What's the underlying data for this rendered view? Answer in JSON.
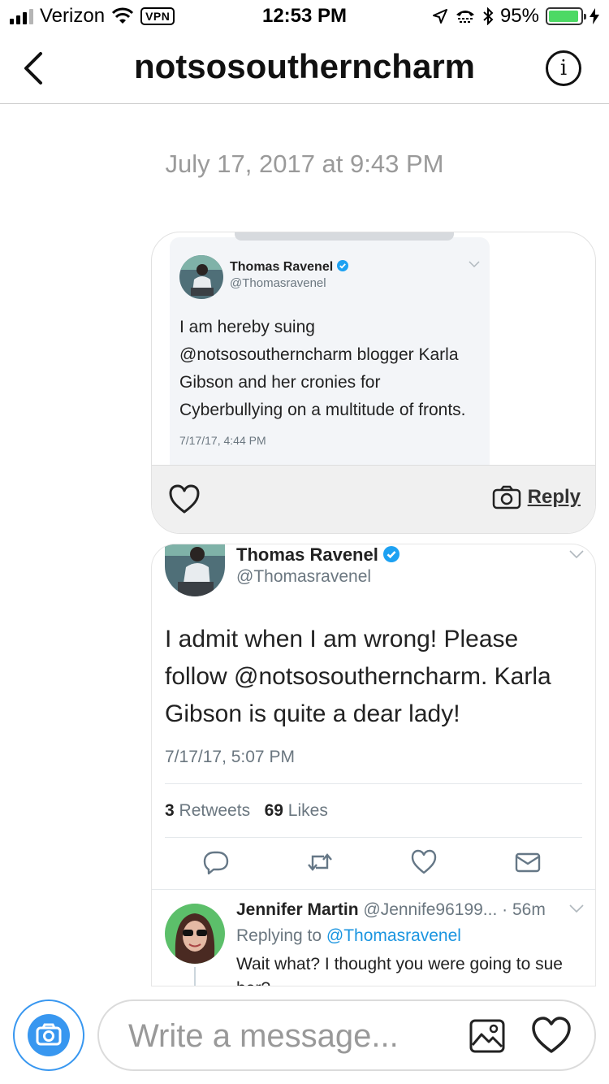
{
  "status_bar": {
    "carrier": "Verizon",
    "vpn": "VPN",
    "time": "12:53 PM",
    "battery": "95%",
    "battery_level": 0.95,
    "battery_color": "#4cd964"
  },
  "nav": {
    "title": "notsosoutherncharm",
    "back_icon": "chevron-left-icon",
    "info_icon": "info-icon"
  },
  "thread": {
    "date_separator": "July 17, 2017 at 9:43 PM",
    "message_1": {
      "tweet": {
        "name": "Thomas Ravenel",
        "handle": "@Thomasravenel",
        "text": "I am hereby suing @notsosoutherncharm blogger Karla Gibson and her cronies for Cyberbullying on a multitude of fronts.",
        "timestamp": "7/17/17, 4:44 PM"
      },
      "reply_label": "Reply"
    },
    "message_2": {
      "tweet": {
        "name": "Thomas Ravenel",
        "handle": "@Thomasravenel",
        "text": "I admit when I am wrong!  Please follow @notsosoutherncharm. Karla Gibson is quite a dear lady!",
        "timestamp": "7/17/17, 5:07 PM",
        "retweets_count": "3",
        "retweets_label": "Retweets",
        "likes_count": "69",
        "likes_label": "Likes"
      },
      "reply": {
        "name": "Jennifer Martin",
        "handle": "@Jennife96199...",
        "age": "· 56m",
        "replying_prefix": "Replying to",
        "replying_to": "@Thomasravenel",
        "text": "Wait what? I thought you were going to sue her?"
      }
    }
  },
  "composer": {
    "placeholder": "Write a message...",
    "camera_color": "#3897f0"
  },
  "colors": {
    "twitter_blue": "#1b95e0",
    "verified": "#1da1f2",
    "instagram_blue": "#3897f0"
  }
}
